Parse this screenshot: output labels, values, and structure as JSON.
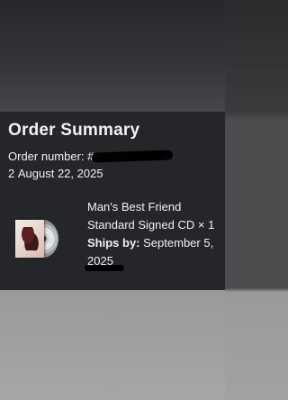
{
  "order_summary": {
    "title": "Order Summary",
    "order_number_label": "Order number: #",
    "order_number_suffix": "2",
    "order_date": "August 22, 2025"
  },
  "item": {
    "name": "Man's Best Friend",
    "variant": "Standard Signed CD",
    "quantity_text": "× 1",
    "ships_by_label": "Ships by:",
    "ships_by_date": "September 5, 2025",
    "thumbnail_icon": "cd-album-icon"
  },
  "colors": {
    "card_background": "#242629",
    "text": "#f1f1f1",
    "redaction": "#000000"
  }
}
